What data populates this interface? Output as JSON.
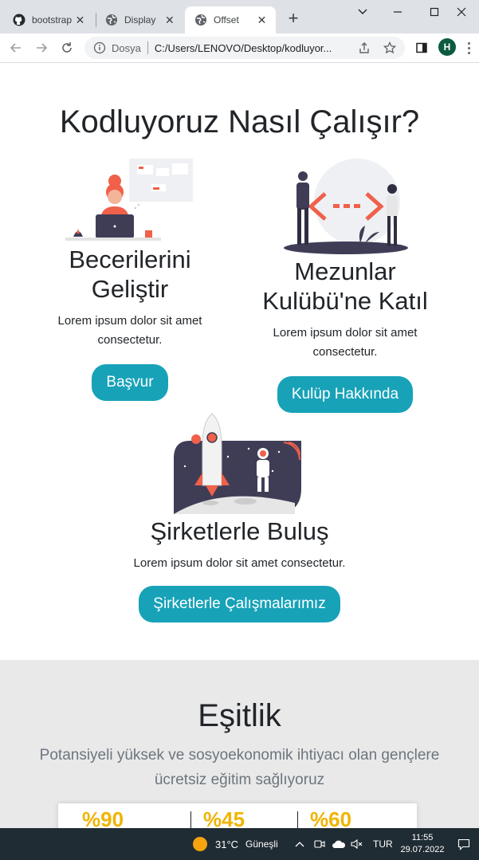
{
  "browser": {
    "tabs": [
      {
        "title": "bootstrap",
        "icon": "github-icon"
      },
      {
        "title": "Display",
        "icon": "globe-icon"
      },
      {
        "title": "Offset",
        "icon": "globe-icon"
      }
    ],
    "new_tab": "+",
    "address": {
      "scheme": "Dosya",
      "url": "C:/Users/LENOVO/Desktop/kodluyor..."
    },
    "profile_initial": "H"
  },
  "page": {
    "title": "Kodluyoruz Nasıl Çalışır?",
    "cards": [
      {
        "heading_1": "Becerilerini",
        "heading_2": "Geliştir",
        "text_1": "Lorem ipsum dolor sit amet",
        "text_2": "consectetur.",
        "button": "Başvur"
      },
      {
        "heading_1": "Mezunlar",
        "heading_2": "Kulübü'ne Katıl",
        "text_1": "Lorem ipsum dolor sit amet",
        "text_2": "consectetur.",
        "button": "Kulüp Hakkında"
      },
      {
        "heading_1": "Şirketlerle Buluş",
        "text_1": "Lorem ipsum dolor sit amet consectetur.",
        "button": "Şirketlerle Çalışmalarımız"
      }
    ],
    "equality": {
      "title": "Eşitlik",
      "lead_1": "Potansiyeli yüksek ve sosyoekonomik ihtiyacı olan gençlere",
      "lead_2": "ücretsiz eğitim sağlıyoruz",
      "stats": [
        "%90",
        "%45",
        "%60"
      ]
    }
  },
  "taskbar": {
    "temperature": "31°C",
    "weather": "Güneşli",
    "language": "TUR",
    "time": "11:55",
    "date": "29.07.2022"
  },
  "colors": {
    "accent": "#17a2b8",
    "illustration_orange": "#f0604a",
    "taskbar": "#202c33"
  }
}
